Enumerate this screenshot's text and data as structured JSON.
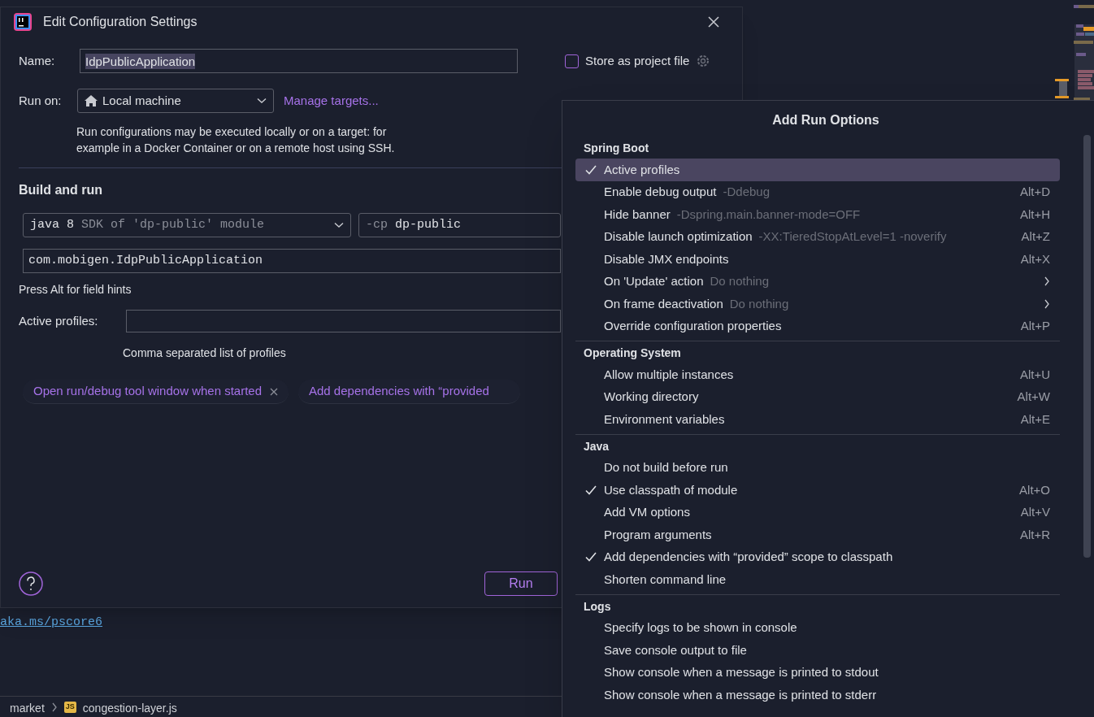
{
  "dialog": {
    "title": "Edit Configuration Settings",
    "name": {
      "label": "Name:",
      "value": "IdpPublicApplication"
    },
    "store_as_project_file": {
      "label": "Store as project file",
      "checked": false
    },
    "run_on": {
      "label": "Run on:",
      "value": "Local machine",
      "link": "Manage targets...",
      "description": "Run configurations may be executed locally or on a target: for\nexample in a Docker Container or on a remote host using SSH."
    },
    "build_and_run": {
      "title": "Build and run",
      "sdk": {
        "value": "java 8",
        "hint": "SDK of 'dp-public' module"
      },
      "classpath": {
        "flag": "-cp",
        "value": "dp-public"
      },
      "main_class": "com.mobigen.IdpPublicApplication",
      "field_hint": "Press Alt for field hints"
    },
    "active_profiles": {
      "label": "Active profiles:",
      "hint": "Comma separated list of profiles"
    },
    "chips": [
      {
        "label": "Open run/debug tool window when started",
        "removable": true
      },
      {
        "label": "Add dependencies with “provided",
        "removable": false
      }
    ],
    "run_button": "Run"
  },
  "editor": {
    "link": "aka.ms/pscore6",
    "breadcrumb": [
      "market",
      "congestion-layer.js"
    ],
    "file_icon": "JS"
  },
  "popup": {
    "title": "Add Run Options",
    "sections": [
      {
        "title": "Spring Boot",
        "items": [
          {
            "label": "Active profiles",
            "checked": true,
            "selected": true,
            "submenu": false
          },
          {
            "label": "Enable debug output",
            "hint": "-Ddebug",
            "shortcut": "Alt+D",
            "checked": false,
            "selected": false,
            "submenu": false
          },
          {
            "label": "Hide banner",
            "hint": "-Dspring.main.banner-mode=OFF",
            "shortcut": "Alt+H",
            "checked": false,
            "selected": false,
            "submenu": false
          },
          {
            "label": "Disable launch optimization",
            "hint": "-XX:TieredStopAtLevel=1 -noverify",
            "shortcut": "Alt+Z",
            "checked": false,
            "selected": false,
            "submenu": false
          },
          {
            "label": "Disable JMX endpoints",
            "shortcut": "Alt+X",
            "checked": false,
            "selected": false,
            "submenu": false
          },
          {
            "label": "On 'Update' action",
            "hint": "Do nothing",
            "checked": false,
            "selected": false,
            "submenu": true
          },
          {
            "label": "On frame deactivation",
            "hint": "Do nothing",
            "checked": false,
            "selected": false,
            "submenu": true
          },
          {
            "label": "Override configuration properties",
            "shortcut": "Alt+P",
            "checked": false,
            "selected": false,
            "submenu": false
          }
        ]
      },
      {
        "title": "Operating System",
        "items": [
          {
            "label": "Allow multiple instances",
            "shortcut": "Alt+U",
            "checked": false,
            "selected": false,
            "submenu": false
          },
          {
            "label": "Working directory",
            "shortcut": "Alt+W",
            "checked": false,
            "selected": false,
            "submenu": false
          },
          {
            "label": "Environment variables",
            "shortcut": "Alt+E",
            "checked": false,
            "selected": false,
            "submenu": false
          }
        ]
      },
      {
        "title": "Java",
        "items": [
          {
            "label": "Do not build before run",
            "checked": false,
            "selected": false,
            "submenu": false
          },
          {
            "label": "Use classpath of module",
            "shortcut": "Alt+O",
            "checked": true,
            "selected": false,
            "submenu": false
          },
          {
            "label": "Add VM options",
            "shortcut": "Alt+V",
            "checked": false,
            "selected": false,
            "submenu": false
          },
          {
            "label": "Program arguments",
            "shortcut": "Alt+R",
            "checked": false,
            "selected": false,
            "submenu": false
          },
          {
            "label": "Add dependencies with “provided” scope to classpath",
            "checked": true,
            "selected": false,
            "submenu": false
          },
          {
            "label": "Shorten command line",
            "checked": false,
            "selected": false,
            "submenu": false
          }
        ]
      },
      {
        "title": "Logs",
        "items": [
          {
            "label": "Specify logs to be shown in console",
            "checked": false,
            "selected": false,
            "submenu": false
          },
          {
            "label": "Save console output to file",
            "checked": false,
            "selected": false,
            "submenu": false
          },
          {
            "label": "Show console when a message is printed to stdout",
            "checked": false,
            "selected": false,
            "submenu": false
          },
          {
            "label": "Show console when a message is printed to stderr",
            "checked": false,
            "selected": false,
            "submenu": false
          }
        ]
      }
    ]
  }
}
